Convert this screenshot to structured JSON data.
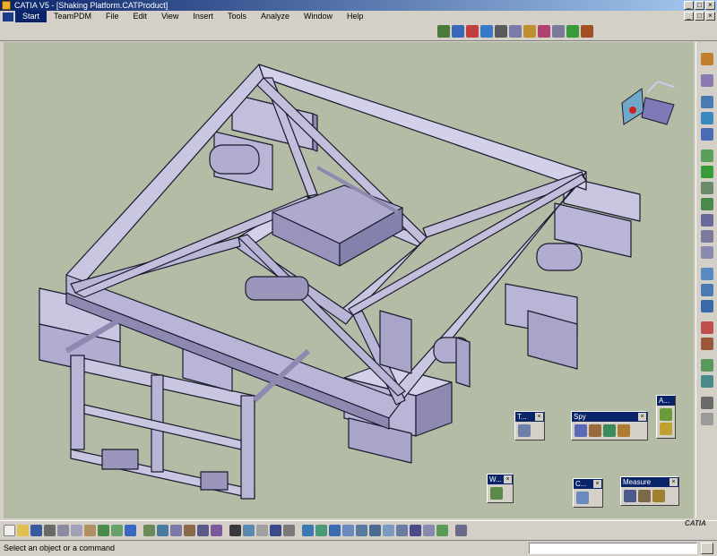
{
  "window": {
    "title": "CATIA V5 - [Shaking Platform.CATProduct]"
  },
  "menu": {
    "items": [
      "Start",
      "TeamPDM",
      "File",
      "Edit",
      "View",
      "Insert",
      "Tools",
      "Analyze",
      "Window",
      "Help"
    ]
  },
  "floating_toolbars": {
    "t": {
      "title": "T..."
    },
    "spy": {
      "title": "Spy"
    },
    "a": {
      "title": "A..."
    },
    "w": {
      "title": "W..."
    },
    "c": {
      "title": "C..."
    },
    "measure": {
      "title": "Measure"
    }
  },
  "logo": {
    "text": "CATIA"
  },
  "status": {
    "message": "Select an object or a command",
    "command_value": ""
  },
  "colors": {
    "viewport_bg": "#b4bca6",
    "frame": "#c9c6e2",
    "frame_dark": "#8d89b0",
    "edge": "#1a1a2e",
    "titlebar": "#0a246a"
  }
}
